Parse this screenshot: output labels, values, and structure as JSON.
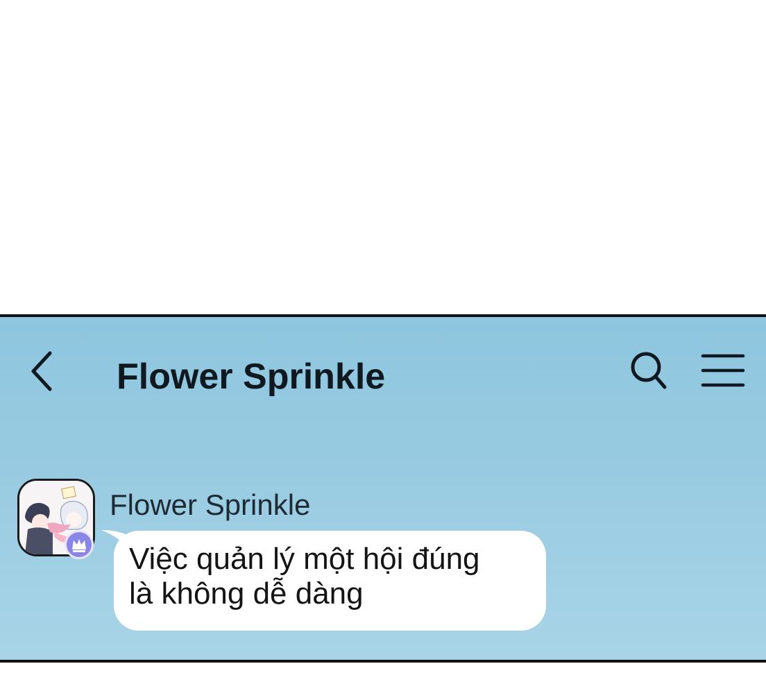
{
  "header": {
    "title": "Flower Sprinkle",
    "back_icon": "chevron-left-icon",
    "search_icon": "search-icon",
    "menu_icon": "hamburger-menu-icon"
  },
  "message": {
    "sender": "Flower Sprinkle",
    "text_lines": [
      "Việc quản lý một hội đúng",
      "là không dễ dàng"
    ],
    "avatar_icon": "avatar",
    "badge_icon": "crown-icon"
  },
  "colors": {
    "panel_bg": "#98cbe1",
    "border": "#111111",
    "bubble": "#ffffff",
    "badge": "#8a86e8"
  }
}
